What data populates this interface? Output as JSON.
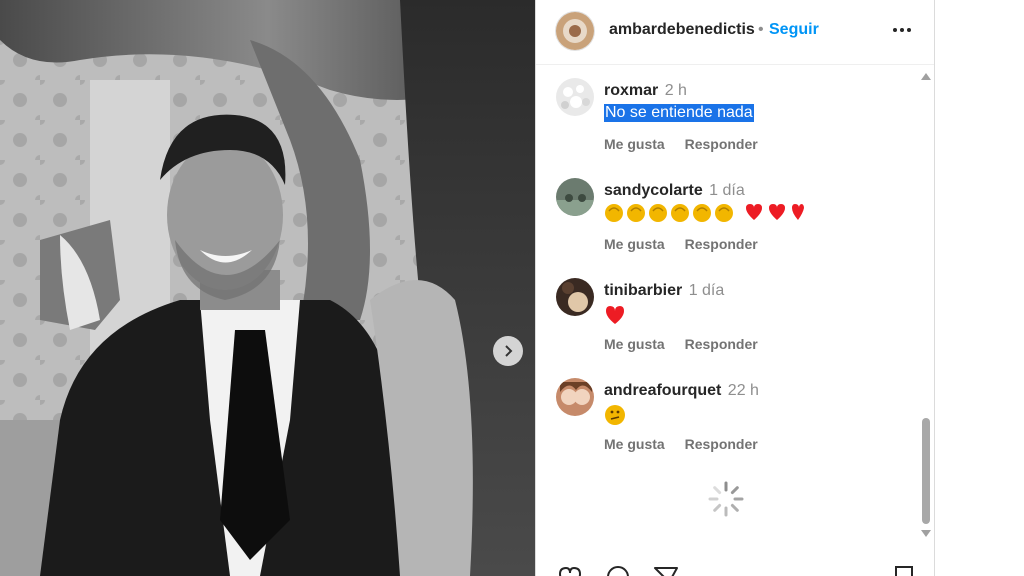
{
  "post": {
    "author": "ambardebenedictis",
    "separator": "•",
    "follow_label": "Seguir"
  },
  "comments": [
    {
      "user": "roxmar",
      "time": "2 h",
      "text": "No se entiende nada",
      "selected": true,
      "like_label": "Me gusta",
      "reply_label": "Responder"
    },
    {
      "user": "sandycolarte",
      "time": "1 día",
      "text": "👏👏👏👏👏👏❤️❤️❤️",
      "emoji": [
        "clap",
        "clap",
        "clap",
        "clap",
        "clap",
        "clap",
        "heart",
        "heart",
        "heart"
      ],
      "like_label": "Me gusta",
      "reply_label": "Responder"
    },
    {
      "user": "tinibarbier",
      "time": "1 día",
      "text": "❤️",
      "emoji": [
        "heart"
      ],
      "like_label": "Me gusta",
      "reply_label": "Responder"
    },
    {
      "user": "andreafourquet",
      "time": "22 h",
      "text": "🫤",
      "emoji": [
        "thinking-face"
      ],
      "like_label": "Me gusta",
      "reply_label": "Responder"
    }
  ],
  "icons": {
    "more": "more-horizontal-icon",
    "next": "chevron-right-icon",
    "loading": "loading-spinner-icon",
    "like": "heart-outline-icon",
    "comment": "comment-icon",
    "share": "share-icon",
    "save": "bookmark-icon"
  },
  "colors": {
    "follow": "#0095f6",
    "selection": "#1a73e8",
    "heart": "#ed1c24",
    "clap": "#f2b600"
  }
}
